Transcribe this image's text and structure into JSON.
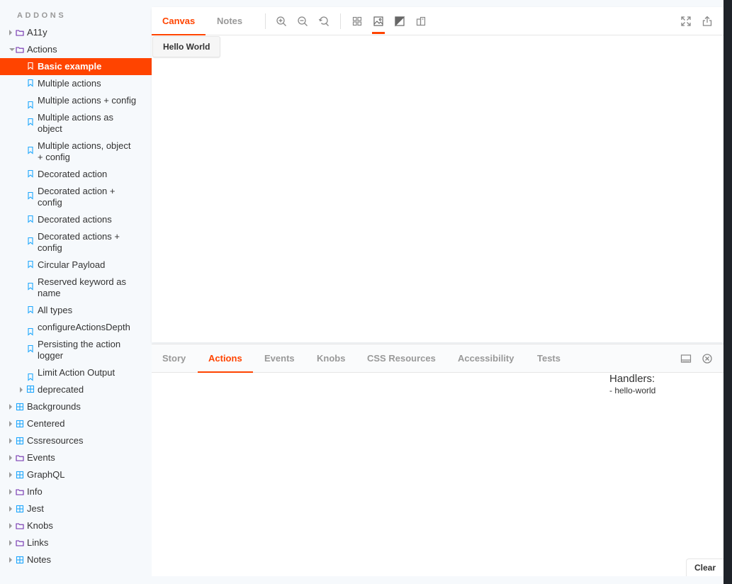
{
  "sidebar": {
    "heading": "ADDONS",
    "items": [
      {
        "label": "A11y",
        "level": 0,
        "type": "folder",
        "expanded": false
      },
      {
        "label": "Actions",
        "level": 0,
        "type": "folder",
        "expanded": true
      },
      {
        "label": "Basic example",
        "level": 1,
        "type": "story",
        "selected": true
      },
      {
        "label": "Multiple actions",
        "level": 1,
        "type": "story"
      },
      {
        "label": "Multiple actions + config",
        "level": 1,
        "type": "story"
      },
      {
        "label": "Multiple actions as object",
        "level": 1,
        "type": "story"
      },
      {
        "label": "Multiple actions, object + config",
        "level": 1,
        "type": "story"
      },
      {
        "label": "Decorated action",
        "level": 1,
        "type": "story"
      },
      {
        "label": "Decorated action + config",
        "level": 1,
        "type": "story"
      },
      {
        "label": "Decorated actions",
        "level": 1,
        "type": "story"
      },
      {
        "label": "Decorated actions + config",
        "level": 1,
        "type": "story"
      },
      {
        "label": "Circular Payload",
        "level": 1,
        "type": "story"
      },
      {
        "label": "Reserved keyword as name",
        "level": 1,
        "type": "story"
      },
      {
        "label": "All types",
        "level": 1,
        "type": "story"
      },
      {
        "label": "configureActionsDepth",
        "level": 1,
        "type": "story"
      },
      {
        "label": "Persisting the action logger",
        "level": 1,
        "type": "story"
      },
      {
        "label": "Limit Action Output",
        "level": 1,
        "type": "story"
      },
      {
        "label": "deprecated",
        "level": 1,
        "type": "component",
        "expanded": false
      },
      {
        "label": "Backgrounds",
        "level": 0,
        "type": "component",
        "expanded": false
      },
      {
        "label": "Centered",
        "level": 0,
        "type": "component",
        "expanded": false
      },
      {
        "label": "Cssresources",
        "level": 0,
        "type": "component",
        "expanded": false
      },
      {
        "label": "Events",
        "level": 0,
        "type": "folder",
        "expanded": false
      },
      {
        "label": "GraphQL",
        "level": 0,
        "type": "component",
        "expanded": false
      },
      {
        "label": "Info",
        "level": 0,
        "type": "folder",
        "expanded": false
      },
      {
        "label": "Jest",
        "level": 0,
        "type": "component",
        "expanded": false
      },
      {
        "label": "Knobs",
        "level": 0,
        "type": "folder",
        "expanded": false
      },
      {
        "label": "Links",
        "level": 0,
        "type": "folder",
        "expanded": false
      },
      {
        "label": "Notes",
        "level": 0,
        "type": "component",
        "expanded": false
      }
    ]
  },
  "toolbar": {
    "tabs": [
      {
        "label": "Canvas",
        "active": true
      },
      {
        "label": "Notes",
        "active": false
      }
    ],
    "tools": [
      "zoom-in-icon",
      "zoom-out-icon",
      "zoom-reset-icon",
      "grid-icon",
      "background-image-icon",
      "contrast-icon",
      "measure-icon"
    ],
    "right_tools": [
      "fullscreen-icon",
      "share-icon"
    ]
  },
  "canvas": {
    "button_label": "Hello World"
  },
  "panel": {
    "tabs": [
      {
        "label": "Story",
        "active": false
      },
      {
        "label": "Actions",
        "active": true
      },
      {
        "label": "Events",
        "active": false
      },
      {
        "label": "Knobs",
        "active": false
      },
      {
        "label": "CSS Resources",
        "active": false
      },
      {
        "label": "Accessibility",
        "active": false
      },
      {
        "label": "Tests",
        "active": false
      }
    ],
    "handlers_title": "Handlers:",
    "handlers": [
      "- hello-world"
    ],
    "clear_label": "Clear",
    "right_tools": [
      "panel-layout-icon",
      "close-panel-icon"
    ]
  },
  "colors": {
    "accent": "#ff4400",
    "story_icon": "#1ea7fd",
    "folder_icon": "#6f2cac",
    "component_icon": "#1ea7fd"
  }
}
